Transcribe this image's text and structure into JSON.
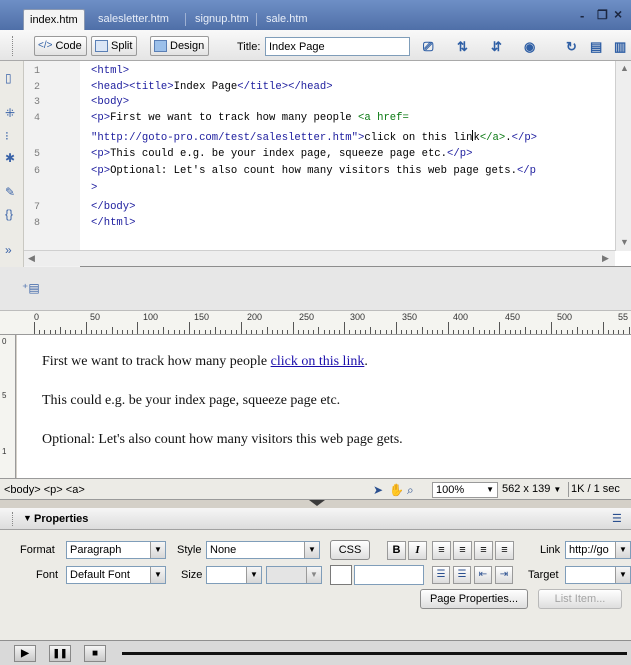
{
  "tabs": [
    {
      "label": "index.htm",
      "active": true
    },
    {
      "label": "salesletter.htm",
      "active": false
    },
    {
      "label": "signup.htm",
      "active": false
    },
    {
      "label": "sale.htm",
      "active": false
    }
  ],
  "window_controls": {
    "minimize": "-",
    "restore": "❐",
    "close": "×"
  },
  "doc_toolbar": {
    "code_label": "Code",
    "split_label": "Split",
    "design_label": "Design",
    "title_label": "Title:",
    "title_value": "Index Page"
  },
  "code_lines": [
    {
      "n": "1"
    },
    {
      "n": "2"
    },
    {
      "n": "3"
    },
    {
      "n": "4"
    },
    {
      "n": "5"
    },
    {
      "n": "6"
    },
    {
      "n": "7"
    },
    {
      "n": "8"
    }
  ],
  "code": {
    "l1": "<html>",
    "l2_a": "<head><title>",
    "l2_b": "Index Page",
    "l2_c": "</title></head>",
    "l3": "<body>",
    "l4_a": "<p>",
    "l4_b": "First we want to track how many people ",
    "l4_c": "<a href=",
    "l4w_a": "\"http://goto-pro.com/test/salesletter.htm\">",
    "l4w_b": "click on this lin",
    "l4w_c": "k",
    "l4w_d": "</a>",
    "l4w_e": ".",
    "l4w_f": "</p>",
    "l5_a": "<p>",
    "l5_b": "This could e.g. be your index page, squeeze page etc.",
    "l5_c": "</p>",
    "l6_a": "<p>",
    "l6_b": "Optional: Let's also count how many visitors this web page gets.",
    "l6_c": "</p",
    "l6w": ">",
    "l7": "</body>",
    "l8": "</html>"
  },
  "ruler": {
    "labels": [
      "0",
      "50",
      "100",
      "150",
      "200",
      "250",
      "300",
      "350",
      "400",
      "450",
      "500",
      "55"
    ],
    "v_labels": [
      "0",
      "5",
      "1"
    ]
  },
  "design": {
    "p1_text": "First we want to track how many people ",
    "p1_link": "click on this link",
    "p1_end": ".",
    "p2": "This could e.g. be your index page, squeeze page etc.",
    "p3": "Optional: Let's also count how many visitors this web page gets."
  },
  "status": {
    "breadcrumb": "<body> <p> <a>",
    "zoom": "100%",
    "size": "562 x 139",
    "download": "1K / 1 sec"
  },
  "properties": {
    "title": "Properties",
    "format_label": "Format",
    "format_value": "Paragraph",
    "style_label": "Style",
    "style_value": "None",
    "css_label": "CSS",
    "bold_label": "B",
    "italic_label": "I",
    "link_label": "Link",
    "link_value": "http://go",
    "font_label": "Font",
    "font_value": "Default Font",
    "size_label": "Size",
    "target_label": "Target",
    "page_properties_label": "Page Properties...",
    "list_item_label": "List Item..."
  },
  "playback": {
    "play": "▶",
    "pause": "❚❚",
    "stop": "■"
  }
}
